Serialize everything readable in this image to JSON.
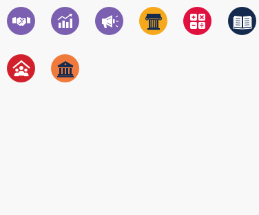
{
  "icons": [
    {
      "name": "handshake-icon",
      "color": "#7b5fb0"
    },
    {
      "name": "growth-chart-icon",
      "color": "#7b5fb0"
    },
    {
      "name": "megaphone-icon",
      "color": "#7b5fb0"
    },
    {
      "name": "column-pillar-icon",
      "color": "#f6a81c"
    },
    {
      "name": "calculator-icon",
      "color": "#e0103f"
    },
    {
      "name": "open-book-icon",
      "color": "#152a4f"
    },
    {
      "name": "community-home-icon",
      "color": "#d1202b"
    },
    {
      "name": "bank-building-icon",
      "color": "#f07a3c"
    }
  ]
}
